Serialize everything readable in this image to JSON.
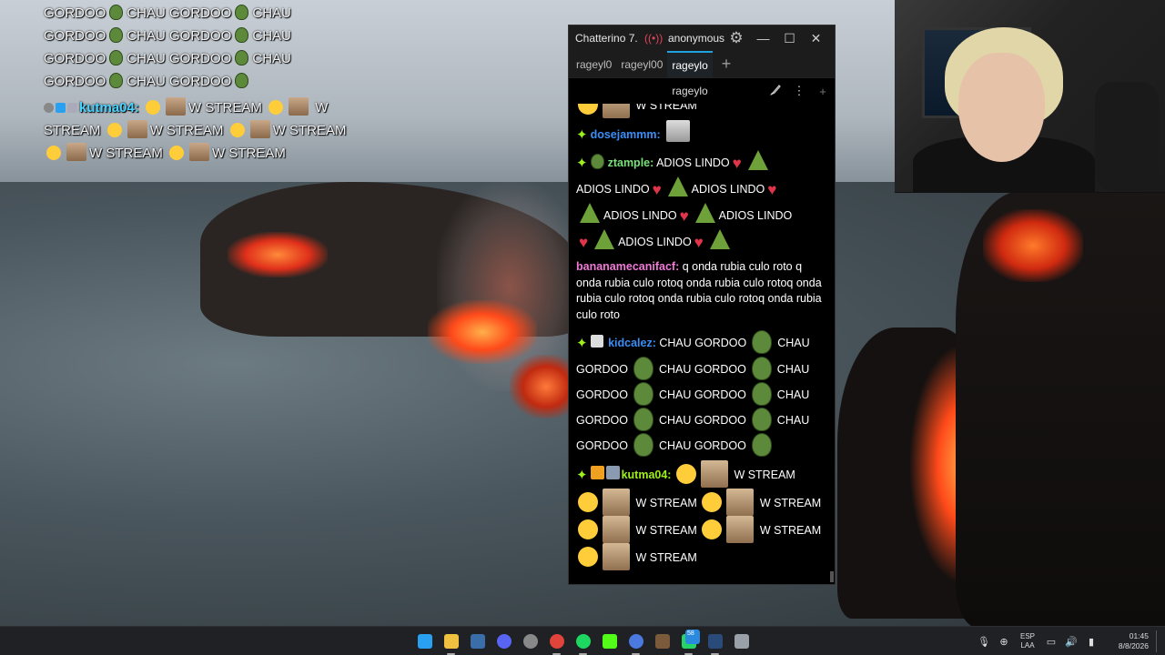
{
  "overlay": {
    "lines": [
      "GORDOO",
      "CHAU GORDOO",
      "CHAU",
      "GORDOO",
      "CHAU GORDOO",
      "CHAU",
      "GORDOO",
      "CHAU GORDOO",
      "CHAU",
      "GORDOO",
      "CHAU GORDOO"
    ],
    "kutma_user": "kutma04:",
    "w_stream": "W STREAM",
    "w": "W",
    "stream": "STREAM"
  },
  "window": {
    "title": "Chatterino 7.",
    "live_icon": "((•))",
    "account": "anonymous",
    "min": "—",
    "max": "☐",
    "close": "✕",
    "tabs": [
      {
        "label": "rageyl0"
      },
      {
        "label": "rageyl00"
      },
      {
        "label": "rageylo"
      }
    ],
    "add_tab": "+",
    "split_channel": "rageylo",
    "split_more": "⋮",
    "split_add": "+"
  },
  "chat": {
    "top_partial": "W STREAM",
    "m1_user": "dosejammm:",
    "m2_user": "ztample:",
    "adios": "ADIOS LINDO",
    "m3_user": "bananamecanifacf:",
    "m3_text": "q onda rubia culo roto q onda rubia culo rotoq onda rubia culo rotoq onda rubia culo rotoq onda rubia culo rotoq onda rubia culo roto",
    "m4_user": "kidcalez:",
    "chau": "CHAU",
    "gordoo": "GORDOO",
    "chau_gordoo": "CHAU GORDOO",
    "m5_user": "kutma04:",
    "w_stream": "W STREAM"
  },
  "taskbar": {
    "notif_count": "58",
    "lang_top": "ESP",
    "lang_bottom": "LAA",
    "time": "01:45",
    "date": "8/8/2026",
    "icons": [
      "windows-start-icon",
      "file-explorer-icon",
      "steam-icon",
      "discord-icon",
      "obs-icon",
      "chrome-icon",
      "spotify-icon",
      "kick-icon",
      "chatterino-icon",
      "minecraft-icon",
      "whatsapp-icon",
      "steam2-icon",
      "settings-icon"
    ],
    "colors": [
      "#2aa0f0",
      "#f0c040",
      "#3a6ea8",
      "#5865f2",
      "#888888",
      "#e0443a",
      "#1ed760",
      "#53fc18",
      "#4a7ae0",
      "#7a5a3a",
      "#25d366",
      "#2a4a7a",
      "#9aa0a8"
    ]
  }
}
